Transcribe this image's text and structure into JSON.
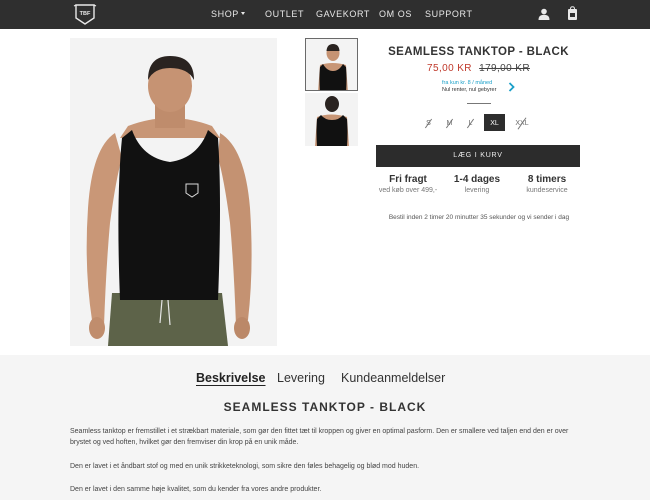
{
  "header": {
    "logo_text": "TBF",
    "nav": [
      {
        "label": "SHOP",
        "has_dropdown": true
      },
      {
        "label": "OUTLET"
      },
      {
        "label": "GAVEKORT"
      },
      {
        "label": "OM OS"
      },
      {
        "label": "SUPPORT"
      }
    ],
    "icons": [
      "user-icon",
      "cart-icon"
    ]
  },
  "product": {
    "title": "SEAMLESS TANKTOP - BLACK",
    "price": "75,00 KR",
    "old_price": "179,00 KR",
    "klarna_line1": "fra kun kr. 8 / måned",
    "klarna_line2": "Nul renter, nul gebyrer",
    "sizes": [
      {
        "label": "S",
        "available": false
      },
      {
        "label": "M",
        "available": false
      },
      {
        "label": "L",
        "available": false
      },
      {
        "label": "XL",
        "available": true,
        "selected": true
      },
      {
        "label": "XXL",
        "available": false
      }
    ],
    "add_to_cart_label": "LÆG I KURV",
    "features": [
      {
        "title": "Fri fragt",
        "subtitle": "ved køb over 499,-"
      },
      {
        "title": "1-4 dages",
        "subtitle": "levering"
      },
      {
        "title": "8 timers",
        "subtitle": "kundeservice"
      }
    ],
    "countdown": "Bestil inden 2 timer 20 minutter 35 sekunder og vi sender i dag"
  },
  "tabs": [
    {
      "label": "Beskrivelse",
      "active": true
    },
    {
      "label": "Levering",
      "active": false
    },
    {
      "label": "Kundeanmeldelser",
      "active": false
    }
  ],
  "description": {
    "title": "SEAMLESS TANKTOP - BLACK",
    "paragraphs": [
      "Seamless tanktop er fremstillet i et strækbart materiale, som gør den fittet tæt til kroppen og giver en optimal pasform. Den er smallere ved taljen end den er over brystet og ved hoften, hvilket gør den fremviser din krop på en unik måde.",
      "Den er lavet i et åndbart stof og med en unik strikketeknologi, som sikre den føles behagelig og blød mod huden.",
      "Den er lavet i den samme høje kvalitet, som du kender fra vores andre produkter."
    ]
  },
  "colors": {
    "header_bg": "#2f2f2f",
    "price_red": "#c0392b",
    "button_bg": "#2c2c2c",
    "klarna_blue": "#1aa0c9",
    "lower_bg": "#f5f5f5"
  }
}
